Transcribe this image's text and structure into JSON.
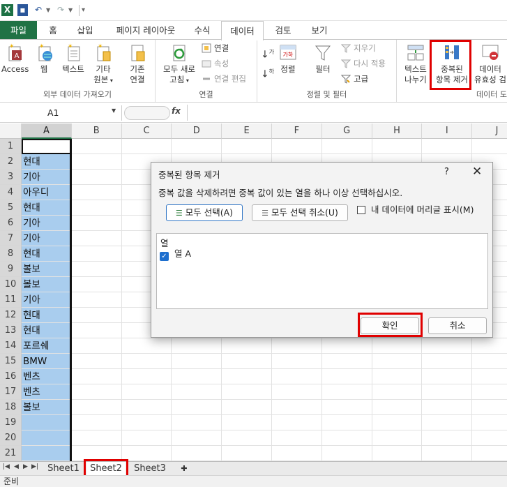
{
  "qat": {
    "logo": "X",
    "save": "💾",
    "undo": "↶",
    "redo": "↷"
  },
  "tabs": {
    "file": "파일",
    "home": "홈",
    "insert": "삽입",
    "layout": "페이지 레이아웃",
    "formula": "수식",
    "data": "데이터",
    "review": "검토",
    "view": "보기"
  },
  "ribbon": {
    "groups": {
      "external": "외부 데이터 가져오기",
      "connections": "연결",
      "sortfilter": "정렬 및 필터",
      "datatools": "데이터 도"
    },
    "access": "Access",
    "web": "웹",
    "text": "텍스트",
    "other1": "기타",
    "other2": "원본",
    "existing1": "기존",
    "existing2": "연결",
    "refresh1": "모두 새로",
    "refresh2": "고침",
    "conn": "연결",
    "props": "속성",
    "editlinks": "연결 편집",
    "sort": "정렬",
    "filter": "필터",
    "clear": "지우기",
    "reapply": "다시 적용",
    "advanced": "고급",
    "t2c1": "텍스트",
    "t2c2": "나누기",
    "dup1": "중복된",
    "dup2": "항목 제거",
    "val1": "데이터",
    "val2": "유효성 검"
  },
  "formula_bar": {
    "name_box": "A1",
    "fx": "fx"
  },
  "grid": {
    "columns": [
      "A",
      "B",
      "C",
      "D",
      "E",
      "F",
      "G",
      "H",
      "I",
      "J"
    ],
    "rows": [
      "1",
      "2",
      "3",
      "4",
      "5",
      "6",
      "7",
      "8",
      "9",
      "10",
      "11",
      "12",
      "13",
      "14",
      "15",
      "16",
      "17",
      "18",
      "19",
      "20",
      "21"
    ],
    "colA": [
      "",
      "현대",
      "기아",
      "아우디",
      "현대",
      "기아",
      "기아",
      "현대",
      "볼보",
      "볼보",
      "기아",
      "현대",
      "현대",
      "포르쉐",
      "BMW",
      "벤츠",
      "벤츠",
      "볼보",
      "",
      "",
      ""
    ]
  },
  "sheets": [
    "Sheet1",
    "Sheet2",
    "Sheet3"
  ],
  "status": "준비",
  "dialog": {
    "title": "중복된 항목 제거",
    "help": "?",
    "close": "✕",
    "message": "중복 값을 삭제하려면 중복 값이 있는 열을 하나 이상 선택하십시오.",
    "select_all": "모두 선택(A)",
    "unselect_all": "모두 선택 취소(U)",
    "header_checkbox": "내 데이터에 머리글 표시(M)",
    "list_header": "열",
    "list_items": [
      "열 A"
    ],
    "ok": "확인",
    "cancel": "취소"
  },
  "colors": {
    "excel_green": "#207245",
    "selection": "#a9cdee",
    "highlight": "#e00000",
    "accent": "#1e6fce"
  }
}
